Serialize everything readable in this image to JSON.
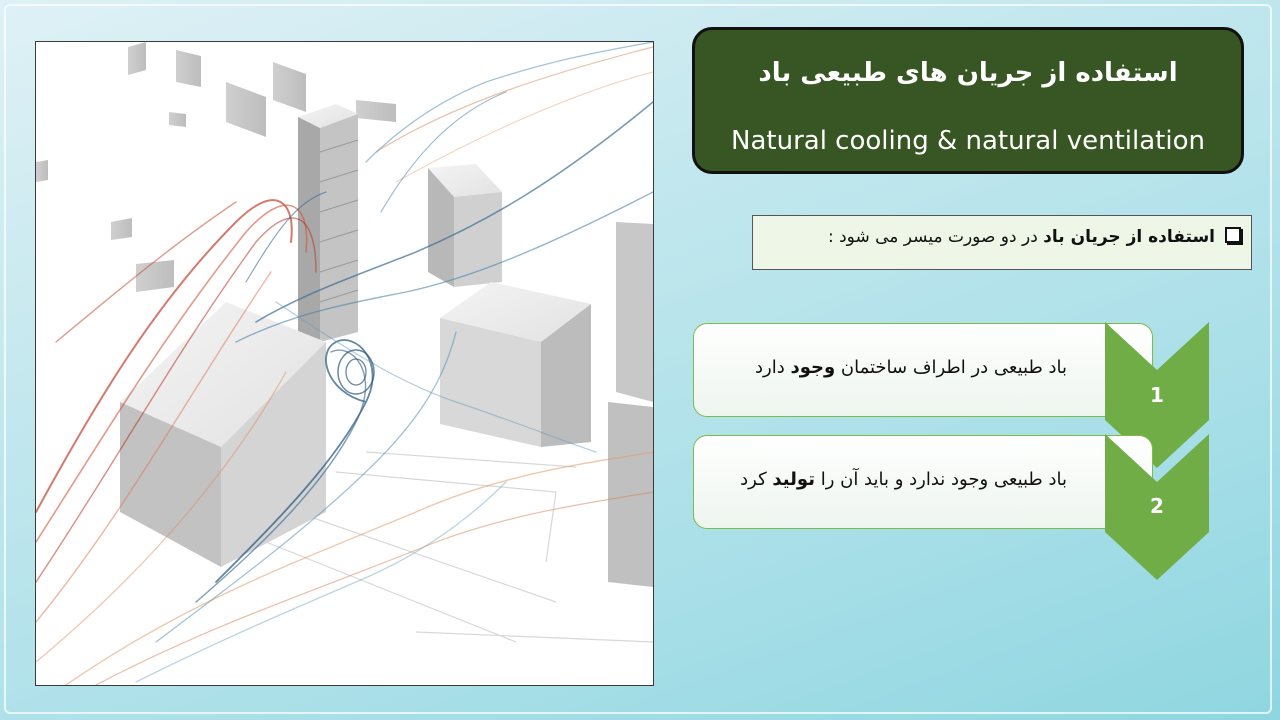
{
  "title": {
    "fa": "استفاده از جریان های طبیعی باد",
    "en": "Natural cooling & natural ventilation"
  },
  "intro": {
    "bold": "استفاده از جریان باد",
    "rest": " در دو صورت میسر می شود :"
  },
  "items": [
    {
      "number": "1",
      "pre": "باد طبیعی در اطراف ساختمان ",
      "bold": "وجود",
      "post": " دارد"
    },
    {
      "number": "2",
      "pre": "باد طبیعی وجود ندارد و باید آن را ",
      "bold": "تولید",
      "post": " کرد"
    }
  ],
  "colors": {
    "title_bg": "#375623",
    "chevron": "#70ad47",
    "item_border": "#7dbb4a",
    "intro_bg": "#eef6e8"
  },
  "icons": [
    "checkbox-bullet-icon"
  ]
}
